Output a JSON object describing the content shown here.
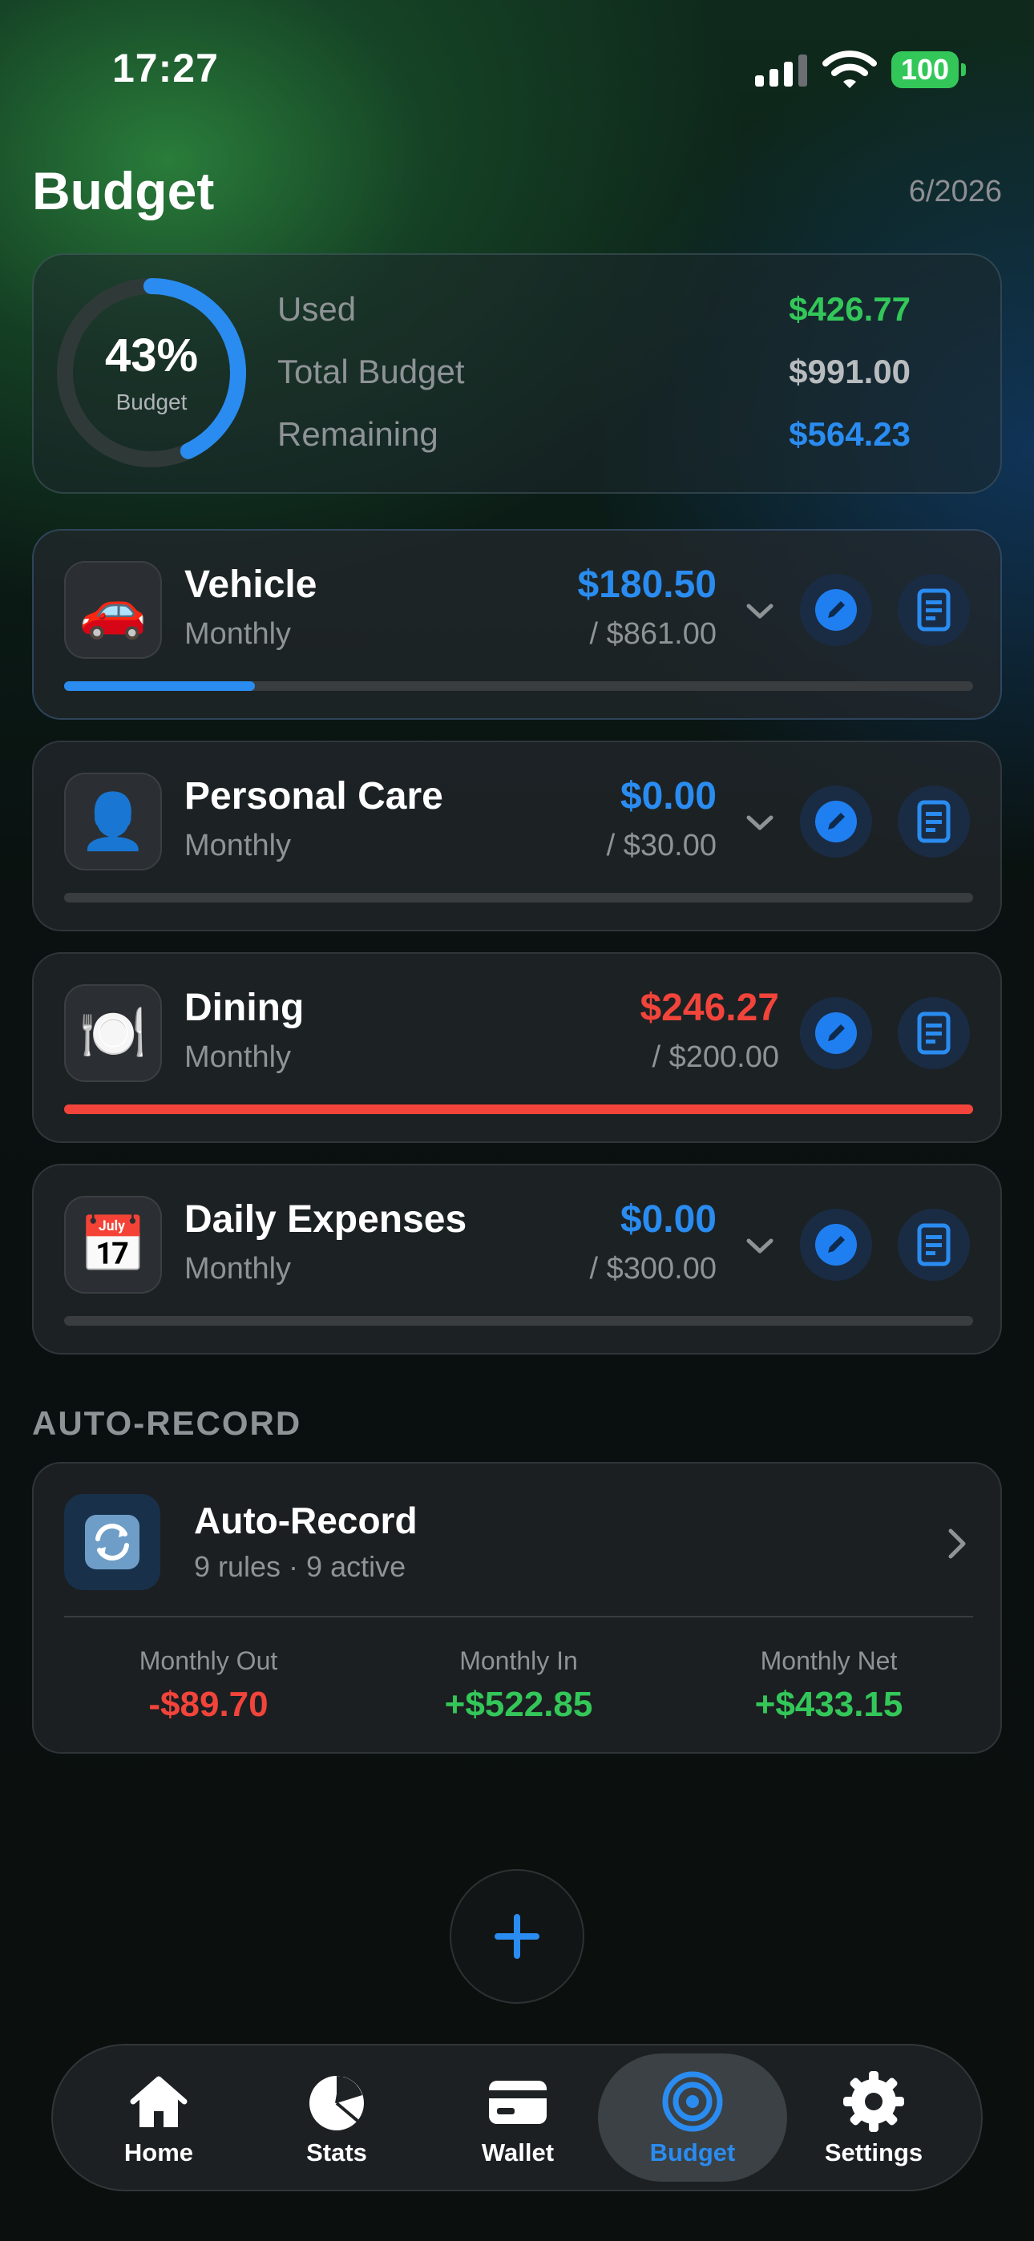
{
  "status_bar": {
    "time": "17:27",
    "battery": "100"
  },
  "header": {
    "title": "Budget",
    "date": "6/2026"
  },
  "summary": {
    "percent_label": "43%",
    "percent_value": 0.43,
    "ring_caption": "Budget",
    "used_label": "Used",
    "used_value": "$426.77",
    "total_label": "Total Budget",
    "total_value": "$991.00",
    "remaining_label": "Remaining",
    "remaining_value": "$564.23"
  },
  "budgets": [
    {
      "name": "Vehicle",
      "period": "Monthly",
      "icon": "car-icon",
      "emoji": "🚗",
      "spent": "$180.50",
      "limit": "/ $861.00",
      "progress": 0.21,
      "status_color": "#2a8cf0",
      "over": false
    },
    {
      "name": "Personal Care",
      "period": "Monthly",
      "icon": "person-icon",
      "emoji": "👤",
      "spent": "$0.00",
      "limit": "/ $30.00",
      "progress": 0.0,
      "status_color": "#2a8cf0",
      "over": false
    },
    {
      "name": "Dining",
      "period": "Monthly",
      "icon": "plate-icon",
      "emoji": "🍽️",
      "spent": "$246.27",
      "limit": "/ $200.00",
      "progress": 1.0,
      "status_color": "#f2443a",
      "over": true
    },
    {
      "name": "Daily Expenses",
      "period": "Monthly",
      "icon": "calendar-icon",
      "emoji": "📅",
      "spent": "$0.00",
      "limit": "/ $300.00",
      "progress": 0.0,
      "status_color": "#2a8cf0",
      "over": false
    }
  ],
  "auto_record": {
    "section_title": "AUTO-RECORD",
    "title": "Auto-Record",
    "subtitle": "9 rules · 9 active",
    "stats": [
      {
        "label": "Monthly Out",
        "value": "-$89.70",
        "color": "#f2443a"
      },
      {
        "label": "Monthly In",
        "value": "+$522.85",
        "color": "#33c759"
      },
      {
        "label": "Monthly Net",
        "value": "+$433.15",
        "color": "#33c759"
      }
    ]
  },
  "tabs": [
    {
      "label": "Home",
      "icon": "home-icon"
    },
    {
      "label": "Stats",
      "icon": "pie-chart-icon"
    },
    {
      "label": "Wallet",
      "icon": "wallet-icon"
    },
    {
      "label": "Budget",
      "icon": "target-icon",
      "active": true
    },
    {
      "label": "Settings",
      "icon": "gear-icon"
    }
  ],
  "colors": {
    "accent": "#2a8cf0",
    "positive": "#33c759",
    "negative": "#f2443a",
    "muted": "#8e9396"
  }
}
